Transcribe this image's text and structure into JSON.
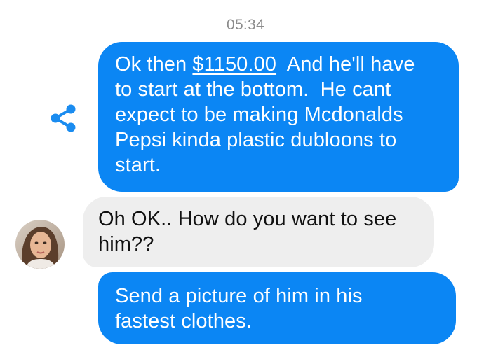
{
  "colors": {
    "outgoing_bubble": "#0b86f4",
    "incoming_bubble": "#eeeeee",
    "share_icon": "#1a8cf0",
    "timestamp": "#8c8c8c"
  },
  "thread": {
    "timestamp": "05:34",
    "messages": [
      {
        "direction": "outgoing",
        "lines": [
          {
            "pre": "Ok then ",
            "link": "$1150.00",
            "post": "  And he'll have"
          },
          {
            "text": "to start at the bottom.  He cant"
          },
          {
            "text": "expect to be making Mcdonalds"
          },
          {
            "text": "Pepsi kinda plastic dubloons to"
          },
          {
            "text": "start."
          }
        ]
      },
      {
        "direction": "incoming",
        "lines": [
          {
            "text": "Oh OK.. How do you want to see"
          },
          {
            "text": "him??"
          }
        ]
      },
      {
        "direction": "outgoing",
        "lines": [
          {
            "text": "Send a picture of him in his"
          },
          {
            "text": "fastest clothes."
          }
        ]
      }
    ]
  },
  "icons": {
    "share": "share-icon",
    "avatar": "contact-avatar"
  }
}
